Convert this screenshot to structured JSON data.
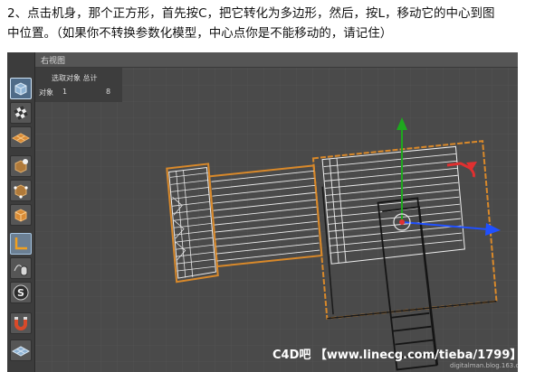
{
  "instructions": {
    "line1": "2、点击机身，那个正方形，首先按C，把它转化为多边形，然后，按L，移动它的中心到图",
    "line2": "中位置。（如果你不转换参数化模型，中心点你是不能移动的，请记住）"
  },
  "viewport": {
    "title": "右视图"
  },
  "info_panel": {
    "header": "选取对象 总计",
    "row_label": "对象",
    "selected": "1",
    "total": "8"
  },
  "watermark": {
    "text": "C4D吧  【www.linecg.com/tieba/1799】",
    "url": "digitalman.blog.163.com"
  },
  "toolbar": {
    "tools": [
      "view-cube-icon",
      "checker-texture-icon",
      "plane-grid-icon",
      "object-mode-icon",
      "point-mode-icon",
      "polygon-mode-icon",
      "axis-mode-icon",
      "mouse-move-icon",
      "snap-s-icon",
      "magnet-icon",
      "grid-floor-icon"
    ]
  },
  "colors": {
    "viewport_bg": "#4a4a4a",
    "selection_outline": "#d9892a",
    "axis_x": "#2050ff",
    "axis_y": "#1ea81e",
    "axis_z": "#e03030"
  }
}
